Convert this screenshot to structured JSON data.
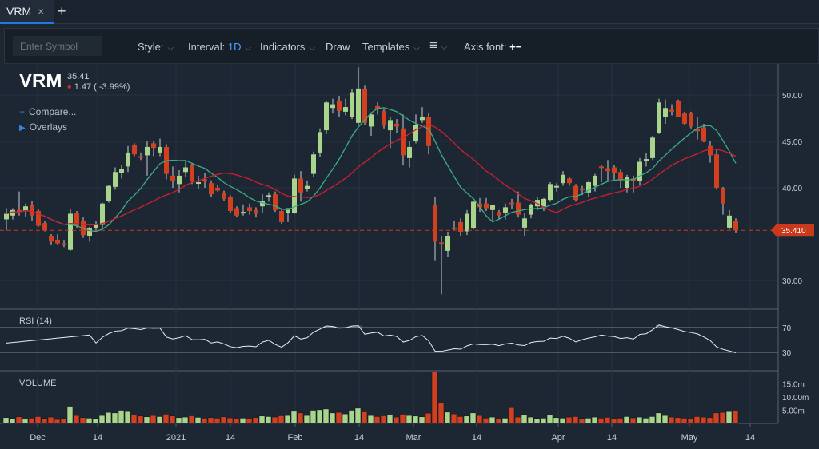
{
  "tabs": [
    {
      "label": "VRM",
      "close": "×"
    }
  ],
  "add_tab": "+",
  "toolbar": {
    "symbol_placeholder": "Enter Symbol",
    "style": "Style:",
    "interval_label": "Interval:",
    "interval_value": "1D",
    "indicators": "Indicators",
    "draw": "Draw",
    "templates": "Templates",
    "menu_icon": "≡",
    "axis_font": "Axis font:",
    "plus": "+",
    "minus": "−",
    "chevron": "⌵"
  },
  "quote": {
    "ticker": "VRM",
    "last": "35.41",
    "arrow": "♦",
    "change": "1.47 ( -3.99%)"
  },
  "side": {
    "compare": "Compare...",
    "overlays": "Overlays",
    "plus_icon": "+",
    "play_icon": "▶"
  },
  "colors": {
    "up": "#a8d48c",
    "down": "#d2401f",
    "ma_fast": "#3aae88",
    "ma_slow": "#d21e2e",
    "price_tag": "#c9391c",
    "bg": "#1d2733"
  },
  "chart_data": {
    "type": "candlestick",
    "price_axis": {
      "ticks": [
        {
          "v": 50,
          "label": "50.00"
        },
        {
          "v": 45,
          "label": "45.00"
        },
        {
          "v": 40,
          "label": "40.00"
        },
        {
          "v": 30,
          "label": "30.00"
        }
      ]
    },
    "last_price_label": "35.410",
    "last_price": 35.41,
    "x_ticks": [
      "Dec",
      "14",
      "2021",
      "14",
      "Feb",
      "14",
      "Mar",
      "14",
      "Apr",
      "14",
      "May",
      "14"
    ],
    "candles": [
      [
        36.6,
        37.8,
        35.4,
        37.2
      ],
      [
        37.0,
        37.8,
        36.6,
        37.6
      ],
      [
        37.6,
        39.6,
        37.0,
        37.4
      ],
      [
        37.5,
        38.3,
        36.9,
        38.0
      ],
      [
        38.2,
        38.6,
        36.4,
        37.0
      ],
      [
        37.5,
        37.7,
        35.8,
        35.9
      ],
      [
        36.2,
        36.4,
        35.3,
        35.4
      ],
      [
        34.8,
        35.0,
        33.8,
        34.2
      ],
      [
        34.4,
        35.0,
        33.8,
        34.0
      ],
      [
        34.0,
        34.3,
        33.6,
        33.8
      ],
      [
        33.3,
        37.7,
        33.2,
        37.2
      ],
      [
        37.3,
        37.5,
        35.7,
        35.9
      ],
      [
        36.4,
        36.8,
        34.6,
        34.9
      ],
      [
        34.8,
        35.8,
        34.2,
        35.6
      ],
      [
        35.6,
        36.4,
        35.3,
        36.0
      ],
      [
        36.0,
        38.4,
        35.6,
        38.3
      ],
      [
        38.6,
        40.3,
        38.4,
        40.2
      ],
      [
        40.1,
        42.2,
        39.8,
        41.7
      ],
      [
        41.6,
        42.5,
        41.0,
        42.0
      ],
      [
        42.3,
        44.5,
        41.7,
        43.8
      ],
      [
        44.6,
        44.8,
        43.4,
        43.6
      ],
      [
        43.4,
        43.8,
        43.0,
        43.3
      ],
      [
        43.5,
        45.0,
        41.3,
        44.4
      ],
      [
        44.8,
        45.0,
        43.4,
        44.3
      ],
      [
        43.8,
        45.3,
        43.4,
        44.4
      ],
      [
        44.4,
        44.7,
        40.9,
        41.5
      ],
      [
        41.3,
        42.3,
        40.0,
        40.7
      ],
      [
        40.4,
        41.9,
        39.5,
        41.3
      ],
      [
        41.7,
        42.8,
        41.2,
        42.2
      ],
      [
        42.5,
        42.7,
        40.4,
        40.7
      ],
      [
        40.5,
        41.3,
        39.9,
        40.6
      ],
      [
        40.9,
        41.6,
        40.0,
        40.8
      ],
      [
        40.5,
        40.8,
        39.0,
        39.3
      ],
      [
        40.0,
        40.3,
        39.6,
        39.7
      ],
      [
        39.5,
        39.7,
        38.6,
        38.8
      ],
      [
        39.0,
        39.2,
        37.3,
        37.5
      ],
      [
        37.8,
        38.0,
        36.8,
        37.0
      ],
      [
        37.3,
        38.2,
        37.0,
        37.4
      ],
      [
        37.9,
        38.3,
        37.1,
        37.5
      ],
      [
        37.6,
        37.9,
        36.8,
        37.2
      ],
      [
        38.0,
        39.3,
        37.3,
        38.6
      ],
      [
        39.1,
        39.5,
        38.5,
        39.2
      ],
      [
        39.3,
        39.6,
        37.4,
        37.6
      ],
      [
        37.5,
        37.8,
        36.1,
        36.3
      ],
      [
        37.3,
        37.8,
        36.3,
        37.8
      ],
      [
        37.3,
        41.4,
        37.2,
        41.0
      ],
      [
        41.0,
        41.8,
        38.5,
        39.5
      ],
      [
        39.9,
        40.8,
        39.6,
        40.2
      ],
      [
        41.5,
        43.9,
        41.2,
        43.6
      ],
      [
        43.8,
        46.4,
        43.3,
        46.0
      ],
      [
        46.2,
        49.4,
        45.8,
        49.2
      ],
      [
        48.6,
        49.6,
        48.0,
        49.0
      ],
      [
        49.4,
        49.9,
        47.6,
        48.3
      ],
      [
        48.2,
        49.6,
        47.8,
        48.7
      ],
      [
        47.6,
        50.6,
        47.4,
        50.3
      ],
      [
        47.0,
        53.0,
        46.8,
        50.7
      ],
      [
        50.7,
        51.0,
        46.8,
        47.0
      ],
      [
        46.6,
        48.0,
        45.6,
        47.9
      ],
      [
        48.8,
        49.2,
        47.9,
        48.5
      ],
      [
        48.3,
        48.5,
        46.4,
        46.7
      ],
      [
        46.2,
        47.6,
        44.3,
        47.3
      ],
      [
        46.9,
        47.4,
        45.9,
        46.6
      ],
      [
        46.4,
        47.9,
        42.4,
        43.5
      ],
      [
        43.2,
        45.0,
        42.2,
        44.4
      ],
      [
        45.0,
        47.9,
        44.8,
        46.8
      ],
      [
        47.3,
        48.7,
        47.0,
        47.6
      ],
      [
        47.6,
        48.1,
        43.6,
        44.5
      ],
      [
        38.2,
        39.0,
        32.1,
        34.2
      ],
      [
        34.1,
        34.8,
        28.5,
        34.0
      ],
      [
        33.2,
        35.2,
        32.5,
        34.8
      ],
      [
        35.7,
        36.4,
        35.4,
        35.6
      ],
      [
        36.3,
        36.7,
        34.8,
        35.2
      ],
      [
        35.3,
        37.6,
        34.9,
        37.2
      ],
      [
        35.6,
        38.6,
        35.5,
        38.5
      ],
      [
        38.3,
        38.9,
        37.4,
        37.9
      ],
      [
        38.3,
        38.9,
        37.5,
        37.8
      ],
      [
        37.6,
        38.2,
        36.4,
        38.1
      ],
      [
        37.4,
        37.6,
        36.6,
        37.0
      ],
      [
        37.3,
        38.3,
        36.6,
        37.9
      ],
      [
        38.4,
        38.8,
        37.7,
        38.3
      ],
      [
        38.4,
        39.6,
        36.8,
        37.1
      ],
      [
        35.7,
        37.3,
        34.8,
        36.7
      ],
      [
        37.1,
        38.3,
        36.7,
        38.2
      ],
      [
        38.0,
        39.0,
        37.6,
        38.7
      ],
      [
        38.0,
        38.9,
        37.5,
        38.8
      ],
      [
        38.7,
        40.6,
        38.5,
        40.4
      ],
      [
        40.1,
        40.5,
        39.6,
        40.2
      ],
      [
        40.5,
        41.8,
        40.2,
        41.4
      ],
      [
        41.0,
        41.2,
        40.2,
        40.5
      ],
      [
        40.2,
        40.4,
        38.5,
        38.7
      ],
      [
        39.9,
        40.2,
        39.2,
        39.8
      ],
      [
        39.5,
        40.8,
        39.0,
        40.6
      ],
      [
        40.2,
        41.5,
        39.6,
        41.3
      ],
      [
        42.3,
        42.5,
        40.6,
        42.2
      ],
      [
        42.1,
        43.0,
        40.7,
        41.8
      ],
      [
        42.2,
        42.5,
        40.8,
        41.6
      ],
      [
        41.7,
        42.0,
        40.0,
        40.9
      ],
      [
        40.0,
        41.4,
        39.5,
        41.2
      ],
      [
        41.0,
        41.3,
        39.5,
        40.7
      ],
      [
        40.7,
        43.2,
        40.3,
        42.8
      ],
      [
        43.1,
        43.7,
        42.3,
        43.1
      ],
      [
        43.2,
        45.6,
        43.0,
        45.4
      ],
      [
        45.9,
        49.6,
        45.8,
        49.2
      ],
      [
        47.6,
        49.5,
        46.9,
        48.6
      ],
      [
        48.4,
        49.0,
        47.8,
        48.2
      ],
      [
        49.4,
        49.5,
        47.6,
        47.6
      ],
      [
        48.0,
        48.2,
        46.8,
        46.9
      ],
      [
        48.1,
        48.2,
        46.4,
        46.6
      ],
      [
        46.3,
        47.6,
        45.2,
        46.1
      ],
      [
        46.5,
        46.9,
        44.9,
        45.0
      ],
      [
        44.5,
        45.0,
        42.7,
        43.5
      ],
      [
        43.6,
        44.2,
        39.8,
        40.0
      ],
      [
        40.0,
        40.1,
        37.1,
        38.3
      ],
      [
        35.7,
        37.6,
        35.5,
        37.0
      ],
      [
        36.4,
        36.7,
        35.1,
        35.41
      ]
    ],
    "rsi": {
      "label": "RSI (14)",
      "ticks": [
        {
          "v": 70,
          "label": "70"
        },
        {
          "v": 30,
          "label": "30"
        }
      ]
    },
    "volume": {
      "label": "VOLUME",
      "unit": "m",
      "ticks": [
        {
          "v": 15,
          "label": "15.0m"
        },
        {
          "v": 10,
          "label": "10.00m"
        },
        {
          "v": 5,
          "label": "5.00m"
        }
      ],
      "values": [
        2.2,
        1.8,
        2.5,
        1.6,
        2.0,
        2.6,
        1.9,
        2.4,
        1.5,
        1.8,
        6.5,
        3.0,
        2.2,
        2.0,
        1.9,
        3.0,
        4.2,
        4.0,
        5.0,
        4.5,
        3.2,
        2.8,
        2.5,
        3.0,
        2.6,
        3.5,
        2.8,
        2.2,
        2.4,
        2.9,
        2.3,
        2.0,
        2.2,
        2.0,
        2.5,
        2.1,
        1.8,
        2.0,
        1.7,
        2.2,
        2.8,
        2.6,
        2.4,
        2.9,
        3.0,
        4.6,
        4.0,
        3.0,
        5.0,
        5.2,
        5.5,
        4.0,
        4.2,
        3.6,
        5.0,
        5.8,
        4.4,
        3.0,
        2.6,
        2.9,
        3.2,
        2.4,
        3.5,
        3.0,
        2.8,
        2.5,
        3.9,
        19.5,
        8.0,
        4.3,
        3.6,
        2.6,
        2.8,
        4.0,
        3.0,
        2.0,
        2.4,
        1.8,
        2.0,
        6.0,
        2.4,
        3.4,
        2.4,
        1.9,
        2.0,
        3.3,
        2.2,
        2.0,
        2.4,
        2.6,
        1.9,
        2.0,
        2.4,
        2.0,
        2.3,
        1.8,
        2.0,
        2.6,
        2.1,
        2.4,
        2.0,
        2.6,
        4.0,
        3.0,
        2.4,
        2.2,
        2.0,
        1.8,
        2.6,
        2.4,
        2.2,
        4.0,
        4.2,
        4.5,
        4.8
      ]
    }
  }
}
